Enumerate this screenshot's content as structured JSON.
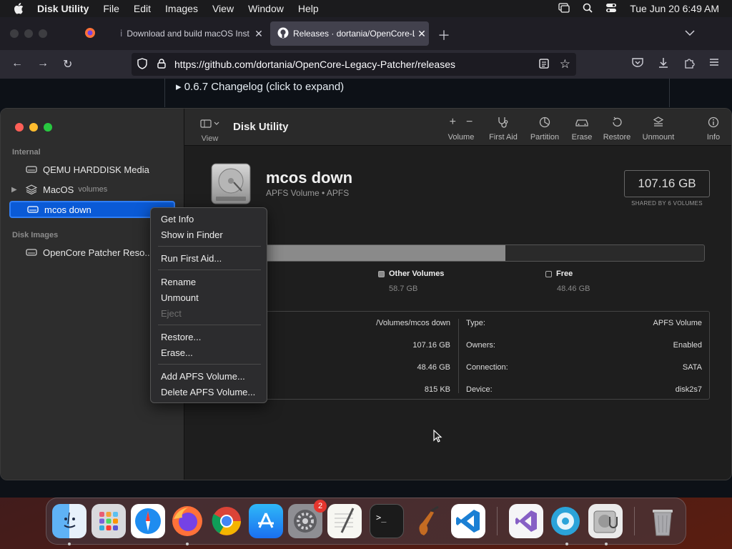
{
  "menubar": {
    "app": "Disk Utility",
    "items": [
      "File",
      "Edit",
      "Images",
      "View",
      "Window",
      "Help"
    ],
    "datetime": "Tue Jun 20  6:49 AM"
  },
  "browser": {
    "tabs": [
      {
        "title": "Download and build macOS Inst",
        "active": false
      },
      {
        "title": "Releases · dortania/OpenCore-L",
        "active": true
      }
    ],
    "url": "https://github.com/dortania/OpenCore-Legacy-Patcher/releases",
    "page_heading": "▸ 0.6.7 Changelog (click to expand)"
  },
  "disk_utility": {
    "sidebar": {
      "sections": [
        {
          "label": "Internal",
          "items": [
            {
              "label": "QEMU HARDDISK Media",
              "sub": ""
            },
            {
              "label": "MacOS",
              "sub": "volumes"
            },
            {
              "label": "mcos down",
              "sub": "",
              "selected": true
            }
          ]
        },
        {
          "label": "Disk Images",
          "items": [
            {
              "label": "OpenCore Patcher Reso...",
              "sub": ""
            }
          ]
        }
      ]
    },
    "toolbar": {
      "view_label": "View",
      "title": "Disk Utility",
      "buttons": [
        "Volume",
        "First Aid",
        "Partition",
        "Erase",
        "Restore",
        "Unmount",
        "Info"
      ]
    },
    "volume": {
      "name": "mcos down",
      "subtitle": "APFS Volume • APFS",
      "size": "107.16 GB",
      "size_caption": "SHARED BY 6 VOLUMES",
      "used_fraction": 0.548
    },
    "legend": [
      {
        "label": "Other Volumes",
        "value": "58.7 GB"
      },
      {
        "label": "Free",
        "value": "48.46 GB"
      }
    ],
    "info_left": [
      "/Volumes/mcos down",
      "107.16 GB",
      "48.46 GB",
      "815 KB"
    ],
    "info_right": [
      {
        "key": "Type:",
        "value": "APFS Volume"
      },
      {
        "key": "Owners:",
        "value": "Enabled"
      },
      {
        "key": "Connection:",
        "value": "SATA"
      },
      {
        "key": "Device:",
        "value": "disk2s7"
      }
    ]
  },
  "context_menu": {
    "items": [
      {
        "label": "Get Info",
        "enabled": true
      },
      {
        "label": "Show in Finder",
        "enabled": true
      },
      {
        "label": "Run First Aid...",
        "enabled": true
      },
      {
        "label": "Rename",
        "enabled": true
      },
      {
        "label": "Unmount",
        "enabled": true
      },
      {
        "label": "Eject",
        "enabled": false
      },
      {
        "label": "Restore...",
        "enabled": true
      },
      {
        "label": "Erase...",
        "enabled": true
      },
      {
        "label": "Add APFS Volume...",
        "enabled": true
      },
      {
        "label": "Delete APFS Volume...",
        "enabled": true
      }
    ]
  },
  "dock": {
    "apps": [
      "Finder",
      "Launchpad",
      "Safari",
      "Firefox",
      "Chrome",
      "App Store",
      "System Preferences",
      "TextEdit",
      "Terminal",
      "GarageBand",
      "VS Code",
      "Visual Studio",
      "Mounty",
      "Disk Utility",
      "Trash"
    ],
    "sysprefs_badge": "2"
  }
}
